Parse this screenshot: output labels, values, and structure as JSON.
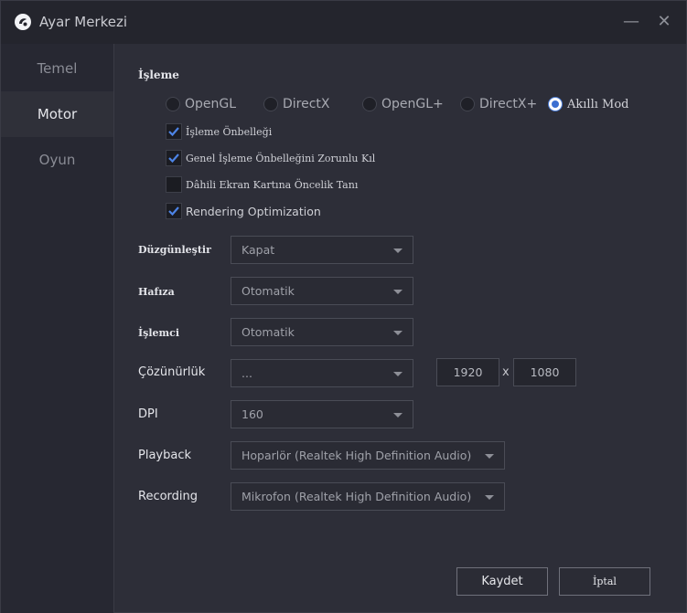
{
  "window": {
    "title": "Ayar Merkezi",
    "minimize_glyph": "—",
    "close_glyph": "✕"
  },
  "sidebar": {
    "items": [
      {
        "label": "Temel",
        "active": false
      },
      {
        "label": "Motor",
        "active": true
      },
      {
        "label": "Oyun",
        "active": false
      }
    ]
  },
  "rendering": {
    "section_title": "İşleme",
    "modes": [
      {
        "label": "OpenGL",
        "checked": false
      },
      {
        "label": "DirectX",
        "checked": false
      },
      {
        "label": "OpenGL+",
        "checked": false
      },
      {
        "label": "DirectX+",
        "checked": false
      },
      {
        "label": "Akıllı Mod",
        "checked": true
      }
    ],
    "options": [
      {
        "label": "İşleme Önbelleği",
        "checked": true
      },
      {
        "label": "Genel İşleme Önbelleğini Zorunlu Kıl",
        "checked": true
      },
      {
        "label": "Dâhili Ekran Kartına Öncelik Tanı",
        "checked": false
      },
      {
        "label": "Rendering Optimization",
        "checked": true
      }
    ]
  },
  "settings": {
    "antialias": {
      "label": "Düzgünleştir",
      "value": "Kapat"
    },
    "memory": {
      "label": "Hafıza",
      "value": "Otomatik"
    },
    "cpu": {
      "label": "İşlemci",
      "value": "Otomatik"
    },
    "resolution": {
      "label": "Çözünürlük",
      "value": "...",
      "width": "1920",
      "separator": "x",
      "height": "1080"
    },
    "dpi": {
      "label": "DPI",
      "value": "160"
    },
    "playback": {
      "label": "Playback",
      "value": "Hoparlör (Realtek High Definition Audio)"
    },
    "recording": {
      "label": "Recording",
      "value": "Mikrofon (Realtek High Definition Audio)"
    }
  },
  "footer": {
    "save_label": "Kaydet",
    "cancel_label": "İptal"
  },
  "colors": {
    "accent": "#3c6fd1",
    "background": "#2d2e38",
    "titlebar": "#24252d"
  }
}
